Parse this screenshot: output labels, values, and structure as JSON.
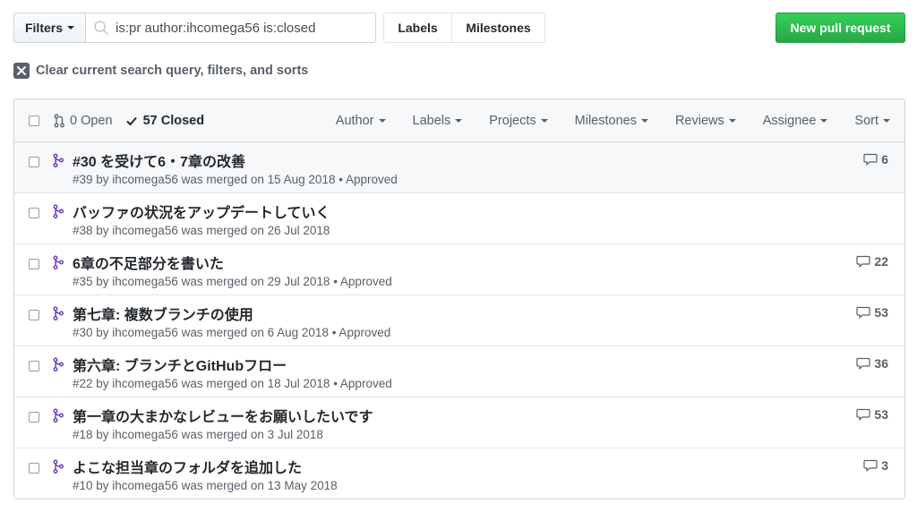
{
  "toolbar": {
    "filters_label": "Filters",
    "search_value": "is:pr author:ihcomega56 is:closed",
    "labels_label": "Labels",
    "milestones_label": "Milestones",
    "new_pr_label": "New pull request"
  },
  "clear": {
    "label": "Clear current search query, filters, and sorts"
  },
  "header": {
    "open_label": "0 Open",
    "closed_label": "57 Closed",
    "sorts": [
      "Author",
      "Labels",
      "Projects",
      "Milestones",
      "Reviews",
      "Assignee",
      "Sort"
    ]
  },
  "colors": {
    "merged_purple": "#6f42c1",
    "accent_green": "#28a745",
    "text_muted": "#586069"
  },
  "pulls": [
    {
      "title": "#30 を受けて6・7章の改善",
      "meta": "#39 by ihcomega56 was merged on 15 Aug 2018 • Approved",
      "comments": "6"
    },
    {
      "title": "バッファの状況をアップデートしていく",
      "meta": "#38 by ihcomega56 was merged on 26 Jul 2018",
      "comments": ""
    },
    {
      "title": "6章の不足部分を書いた",
      "meta": "#35 by ihcomega56 was merged on 29 Jul 2018 • Approved",
      "comments": "22"
    },
    {
      "title": "第七章: 複数ブランチの使用",
      "meta": "#30 by ihcomega56 was merged on 6 Aug 2018 • Approved",
      "comments": "53"
    },
    {
      "title": "第六章: ブランチとGitHubフロー",
      "meta": "#22 by ihcomega56 was merged on 18 Jul 2018 • Approved",
      "comments": "36"
    },
    {
      "title": "第一章の大まかなレビューをお願いしたいです",
      "meta": "#18 by ihcomega56 was merged on 3 Jul 2018",
      "comments": "53"
    },
    {
      "title": "よこな担当章のフォルダを追加した",
      "meta": "#10 by ihcomega56 was merged on 13 May 2018",
      "comments": "3"
    }
  ]
}
